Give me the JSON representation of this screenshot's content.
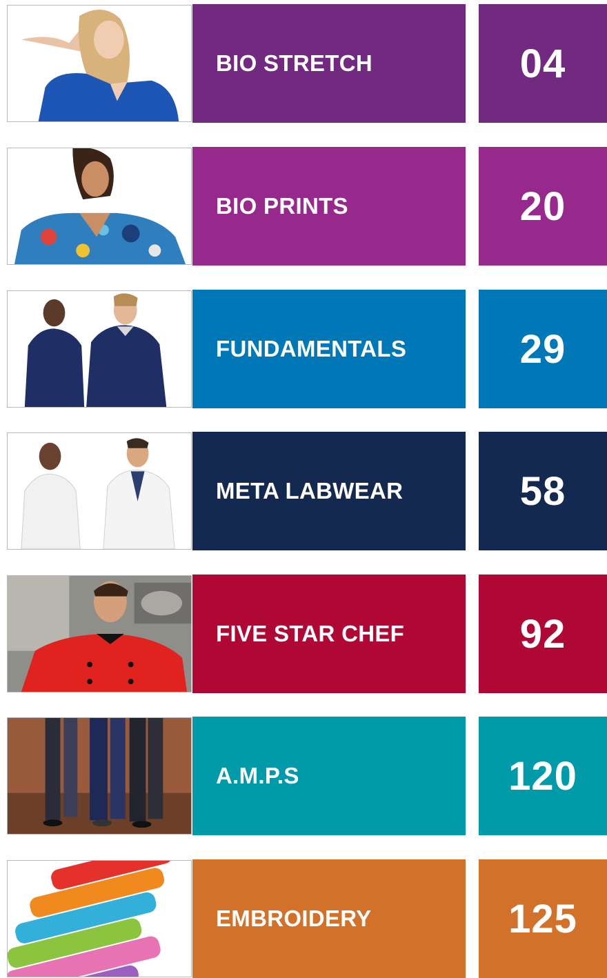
{
  "sections": [
    {
      "label": "BIO STRETCH",
      "page": "04",
      "color": "#722a80",
      "image": "woman-in-blue-scrubs-photo"
    },
    {
      "label": "BIO PRINTS",
      "page": "20",
      "color": "#97298d",
      "image": "woman-in-printed-scrubs-photo"
    },
    {
      "label": "FUNDAMENTALS",
      "page": "29",
      "color": "#0078b8",
      "image": "two-people-in-navy-jackets-photo"
    },
    {
      "label": "META LABWEAR",
      "page": "58",
      "color": "#13294f",
      "image": "two-people-in-lab-coats-photo"
    },
    {
      "label": "FIVE STAR CHEF",
      "page": "92",
      "color": "#b00834",
      "image": "chef-in-red-coat-photo"
    },
    {
      "label": "A.M.P.S",
      "page": "120",
      "color": "#009aa9",
      "image": "people-standing-in-pants-photo"
    },
    {
      "label": "EMBROIDERY",
      "page": "125",
      "color": "#d2712a",
      "image": "thread-spools-photo"
    }
  ]
}
